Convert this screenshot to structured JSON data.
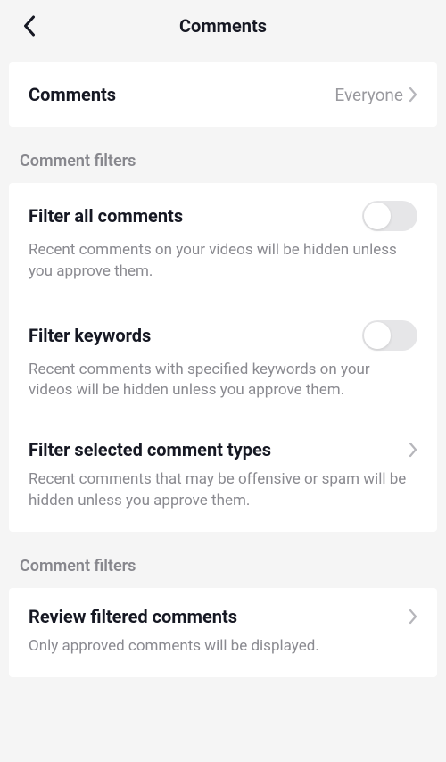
{
  "header": {
    "title": "Comments"
  },
  "comments_setting": {
    "label": "Comments",
    "value": "Everyone"
  },
  "filters_section_1": {
    "header": "Comment filters",
    "items": [
      {
        "title": "Filter all comments",
        "desc": "Recent comments on your videos will be hidden unless you approve them."
      },
      {
        "title": "Filter keywords",
        "desc": "Recent comments with specified keywords on your videos will be hidden unless you approve them."
      },
      {
        "title": "Filter selected comment types",
        "desc": "Recent comments that may be offensive or spam will be hidden unless you approve them."
      }
    ]
  },
  "filters_section_2": {
    "header": "Comment filters",
    "items": [
      {
        "title": "Review filtered comments",
        "desc": "Only approved comments will be displayed."
      }
    ]
  }
}
